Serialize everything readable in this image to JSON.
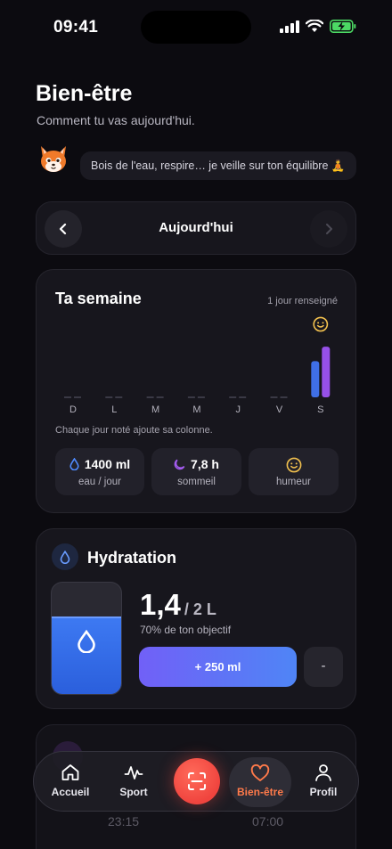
{
  "status_bar": {
    "time": "09:41"
  },
  "header": {
    "title": "Bien-être",
    "subtitle": "Comment tu vas aujourd'hui."
  },
  "assistant": {
    "message": "Bois de l'eau, respire… je veille sur ton équilibre 🧘"
  },
  "day_nav": {
    "label": "Aujourd'hui"
  },
  "week": {
    "title": "Ta semaine",
    "info": "1 jour renseigné",
    "note": "Chaque jour noté ajoute sa colonne.",
    "stats": [
      {
        "value": "1400 ml",
        "label": "eau / jour"
      },
      {
        "value": "7,8 h",
        "label": "sommeil"
      },
      {
        "value": "",
        "label": "humeur"
      }
    ]
  },
  "chart_data": {
    "type": "bar",
    "categories": [
      "D",
      "L",
      "M",
      "M",
      "J",
      "V",
      "S"
    ],
    "series": [
      {
        "values": [
          0,
          0,
          0,
          0,
          0,
          0,
          0.7
        ]
      },
      {
        "values": [
          0,
          0,
          0,
          0,
          0,
          0,
          0.98
        ]
      }
    ],
    "colors": [
      "#3f6fe6",
      "#9650e8"
    ],
    "ylim": [
      0,
      1
    ],
    "annotation": "smiley-icon on S"
  },
  "hydration": {
    "title": "Hydratation",
    "value": "1,4",
    "unit": "/ 2 L",
    "goal_text": "70% de ton objectif",
    "fill_fraction": 0.7,
    "add_label": "+ 250 ml",
    "minus_label": "-"
  },
  "sleep_preview": {
    "time_start": "23:15",
    "time_end": "07:00"
  },
  "tabbar": {
    "items": [
      {
        "label": "Accueil",
        "icon": "home-icon"
      },
      {
        "label": "Sport",
        "icon": "activity-icon"
      },
      {
        "label": "",
        "icon": "scan-icon"
      },
      {
        "label": "Bien-être",
        "icon": "heart-icon"
      },
      {
        "label": "Profil",
        "icon": "user-icon"
      }
    ]
  },
  "colors": {
    "accent_orange": "#ff7a4a",
    "water_blue": "#3d79f2",
    "sleep_purple": "#9650e8",
    "mood_yellow": "#f2c14e"
  }
}
